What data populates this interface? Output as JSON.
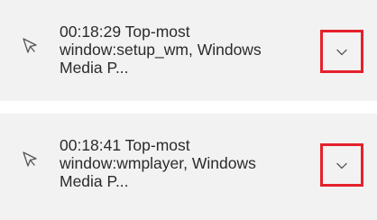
{
  "items": [
    {
      "icon": "mouse-pointer-icon",
      "lines": [
        "00:18:29 Top-most",
        "window:setup_wm, Windows",
        "Media P..."
      ],
      "expand_icon": "chevron-down-icon"
    },
    {
      "icon": "mouse-pointer-icon",
      "lines": [
        "00:18:41 Top-most",
        "window:wmplayer, Windows",
        "Media P..."
      ],
      "expand_icon": "chevron-down-icon"
    }
  ],
  "colors": {
    "card_background": "#f2f2f2",
    "text": "#2b2b2b",
    "highlight_border": "#e5212b",
    "icon": "#555555"
  }
}
